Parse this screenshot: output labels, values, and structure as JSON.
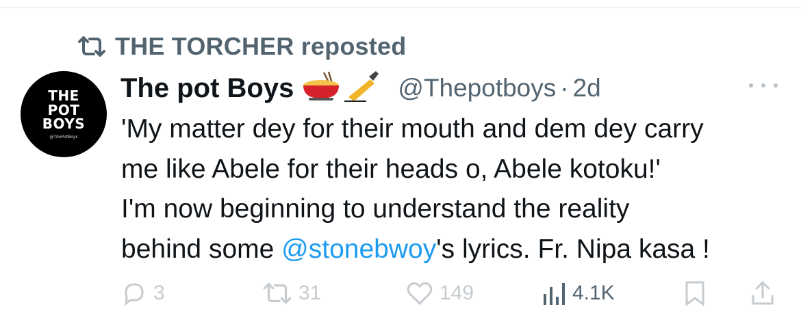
{
  "repost_line": {
    "icon": "repost-icon",
    "text": "THE TORCHER reposted"
  },
  "author": {
    "avatar_lines": [
      "THE",
      "POT",
      "BOYS"
    ],
    "avatar_signature": "@ThePotBoys",
    "display_name": "The pot Boys",
    "name_emojis": "🫕✍️",
    "handle": "@Thepotboys",
    "separator": "·",
    "time_ago": "2d"
  },
  "tweet": {
    "line1": "'My matter dey for their mouth and dem dey carry",
    "line2": "me like Abele for their heads o, Abele kotoku!'",
    "line3": "I'm now beginning to understand the reality",
    "line4_before": "behind some ",
    "line4_mention": "@stonebwoy",
    "line4_after": "'s lyrics. Fr. Nipa kasa !"
  },
  "actions": {
    "replies": "3",
    "reposts": "31",
    "likes": "149",
    "views": "4.1K"
  },
  "colors": {
    "text": "#0f1419",
    "muted": "#536471",
    "link": "#1d9bf0",
    "avatar_bg": "#000000"
  }
}
